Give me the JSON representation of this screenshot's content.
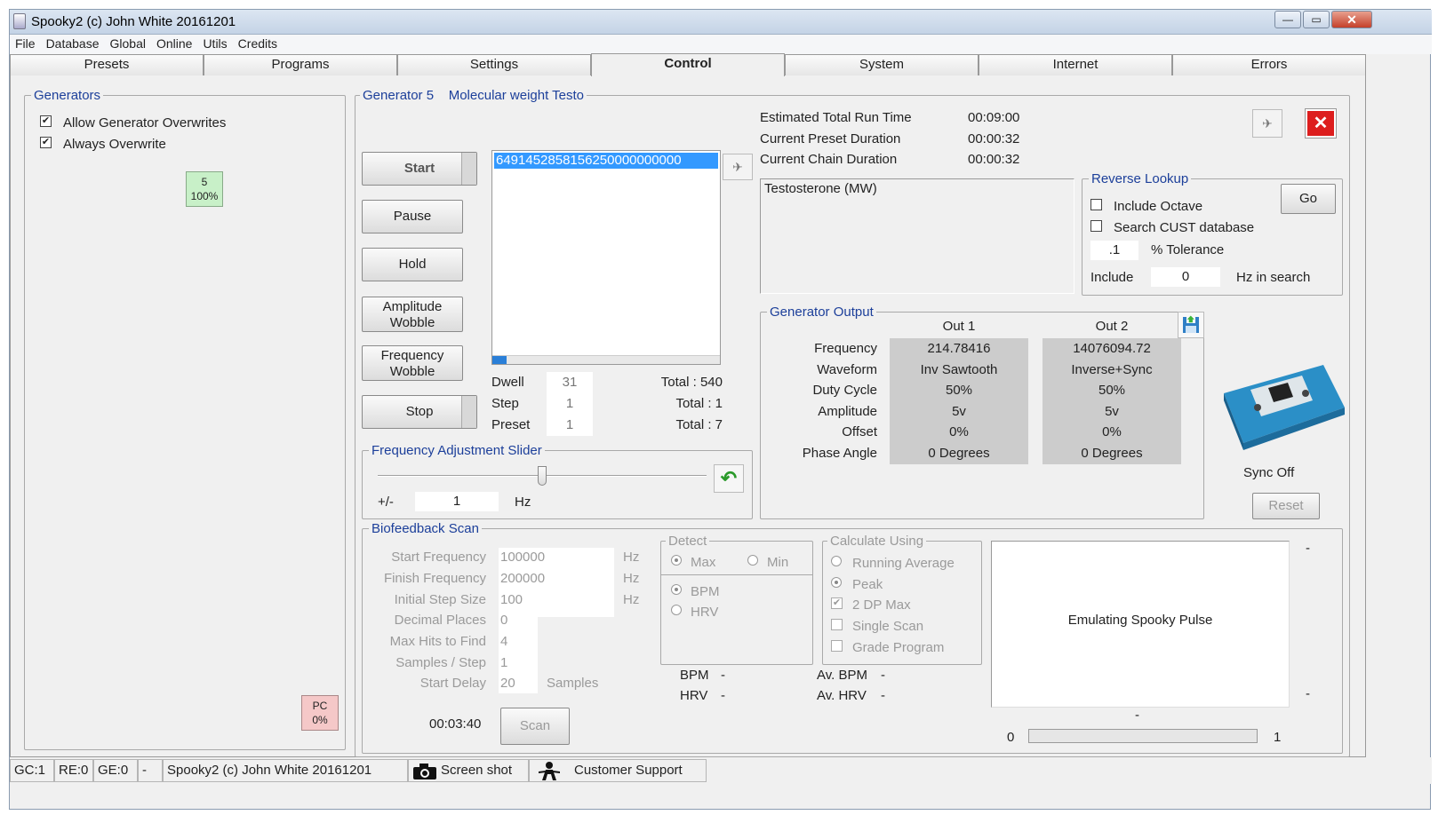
{
  "window": {
    "title": "Spooky2 (c) John White 20161201",
    "min": "—",
    "max": "▭",
    "close": "✕"
  },
  "menu": [
    "File",
    "Database",
    "Global",
    "Online",
    "Utils",
    "Credits"
  ],
  "tabs": [
    "Presets",
    "Programs",
    "Settings",
    "Control",
    "System",
    "Internet",
    "Errors"
  ],
  "generators": {
    "legend": "Generators",
    "allow_overwrites": "Allow Generator Overwrites",
    "always_overwrite": "Always Overwrite",
    "gen_num": "5",
    "gen_pct": "100%",
    "pc_label": "PC",
    "pc_pct": "0%"
  },
  "gen5": {
    "legend": "Generator 5",
    "program": "Molecular weight Testo"
  },
  "controls": {
    "start": "Start",
    "pause": "Pause",
    "hold": "Hold",
    "amp1": "Amplitude",
    "amp2": "Wobble",
    "freq1": "Frequency",
    "freq2": "Wobble",
    "stop": "Stop"
  },
  "freq_list": {
    "selected": "6491452858156250000000000"
  },
  "counters": {
    "dwell_label": "Dwell",
    "dwell": "31",
    "dwell_total": "Total : 540",
    "step_label": "Step",
    "step": "1",
    "step_total": "Total : 1",
    "preset_label": "Preset",
    "preset": "1",
    "preset_total": "Total : 7"
  },
  "times": {
    "est_label": "Estimated Total Run Time",
    "est": "00:09:00",
    "preset_label": "Current Preset Duration",
    "preset": "00:00:32",
    "chain_label": "Current Chain Duration",
    "chain": "00:00:32"
  },
  "description": "Testosterone (MW)",
  "reverse": {
    "legend": "Reverse Lookup",
    "octave": "Include Octave",
    "cust": "Search CUST database",
    "tol": ".1",
    "tol_label": "% Tolerance",
    "include": "Include",
    "hz": "0",
    "hz_label": "Hz in search",
    "go": "Go"
  },
  "output": {
    "legend": "Generator Output",
    "out1": "Out 1",
    "out2": "Out 2",
    "rows": [
      {
        "label": "Frequency",
        "o1": "214.78416",
        "o2": "14076094.72"
      },
      {
        "label": "Waveform",
        "o1": "Inv Sawtooth",
        "o2": "Inverse+Sync"
      },
      {
        "label": "Duty Cycle",
        "o1": "50%",
        "o2": "50%"
      },
      {
        "label": "Amplitude",
        "o1": "5v",
        "o2": "5v"
      },
      {
        "label": "Offset",
        "o1": "0%",
        "o2": "0%"
      },
      {
        "label": "Phase Angle",
        "o1": "0 Degrees",
        "o2": "0 Degrees"
      }
    ]
  },
  "sync": {
    "status": "Sync Off",
    "reset": "Reset"
  },
  "slider": {
    "legend": "Frequency Adjustment Slider",
    "pm": "+/-",
    "value": "1",
    "unit": "Hz",
    "position": 0.5
  },
  "bio": {
    "legend": "Biofeedback Scan",
    "rows": [
      {
        "label": "Start Frequency",
        "value": "100000",
        "unit": "Hz"
      },
      {
        "label": "Finish Frequency",
        "value": "200000",
        "unit": "Hz"
      },
      {
        "label": "Initial Step Size",
        "value": "100",
        "unit": "Hz"
      },
      {
        "label": "Decimal Places",
        "value": "0",
        "unit": ""
      },
      {
        "label": "Max Hits to Find",
        "value": "4",
        "unit": ""
      },
      {
        "label": "Samples / Step",
        "value": "1",
        "unit": ""
      },
      {
        "label": "Start Delay",
        "value": "20",
        "unit": "Samples"
      }
    ],
    "time": "00:03:40",
    "scan": "Scan",
    "detect": "Detect",
    "max": "Max",
    "min": "Min",
    "bpm": "BPM",
    "hrv": "HRV",
    "calc": "Calculate Using",
    "running": "Running Average",
    "peak": "Peak",
    "dp": "2 DP Max",
    "single": "Single Scan",
    "grade": "Grade Program",
    "bpm_l": "BPM",
    "bpm_v": "-",
    "hrv_l": "HRV",
    "hrv_v": "-",
    "avbpm_l": "Av. BPM",
    "avbpm_v": "-",
    "avhrv_l": "Av. HRV",
    "avhrv_v": "-",
    "graph_text": "Emulating Spooky Pulse",
    "dash_tr": "-",
    "dash_br": "-",
    "dash_b": "-",
    "prog_min": "0",
    "prog_max": "1"
  },
  "status": {
    "gc": "GC:1",
    "re": "RE:0",
    "ge": "GE:0",
    "dash": "-",
    "copy": "Spooky2 (c) John White 20161201",
    "screenshot": "Screen shot",
    "support": "Customer Support"
  }
}
